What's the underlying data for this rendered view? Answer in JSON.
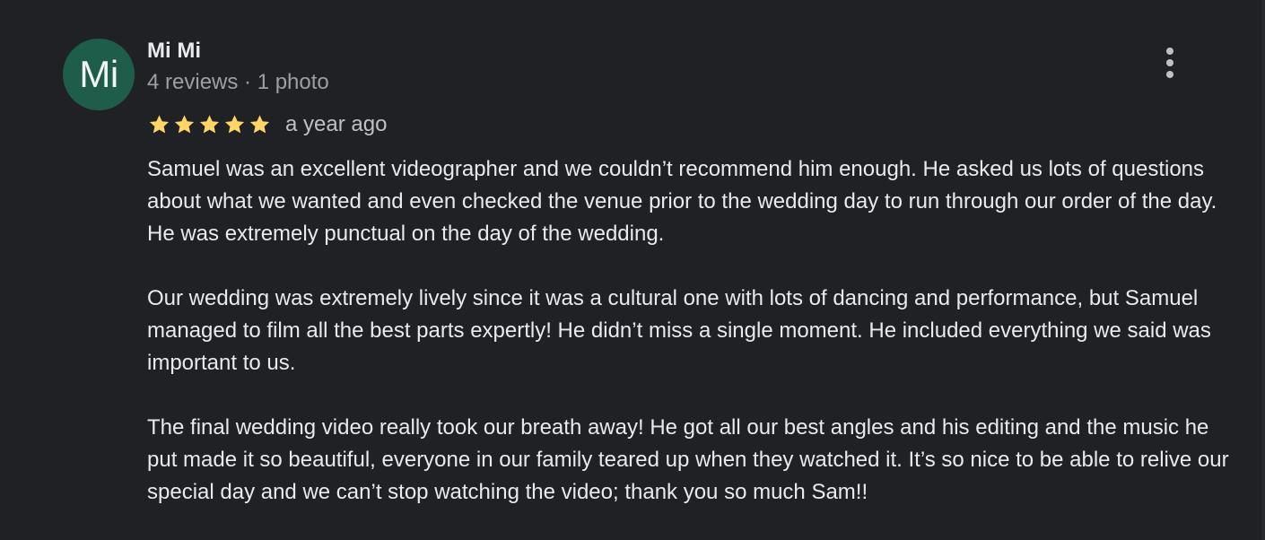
{
  "reviewer": {
    "avatar_initials": "Mi",
    "avatar_color": "#1e5d4a",
    "name": "Mi Mi",
    "meta": "4 reviews · 1 photo"
  },
  "rating": {
    "stars": 5,
    "max_stars": 5,
    "star_color": "#fdd663",
    "date": "a year ago"
  },
  "menu": {
    "icon": "more-vert-icon"
  },
  "review_text": {
    "paragraphs": [
      "Samuel was an excellent videographer and we couldn’t recommend him enough. He asked us lots of questions about what we wanted and even checked the venue prior to the wedding day to run through our order of the day.  He was extremely punctual on the day of the wedding.",
      "Our wedding was extremely lively since it was a cultural one with lots of dancing and performance, but Samuel managed to film all the best parts expertly! He didn’t miss a single moment. He included everything we said was important to us.",
      "The final wedding video really took our breath away! He got all our best angles and his editing and the music he put made it so beautiful, everyone in our family teared up when they watched it. It’s so nice to be able to relive our special day and we can’t stop watching the video; thank you so much Sam!!"
    ]
  },
  "theme": {
    "background": "#202124",
    "text_primary": "#e8eaed",
    "text_secondary": "#9aa0a6"
  }
}
